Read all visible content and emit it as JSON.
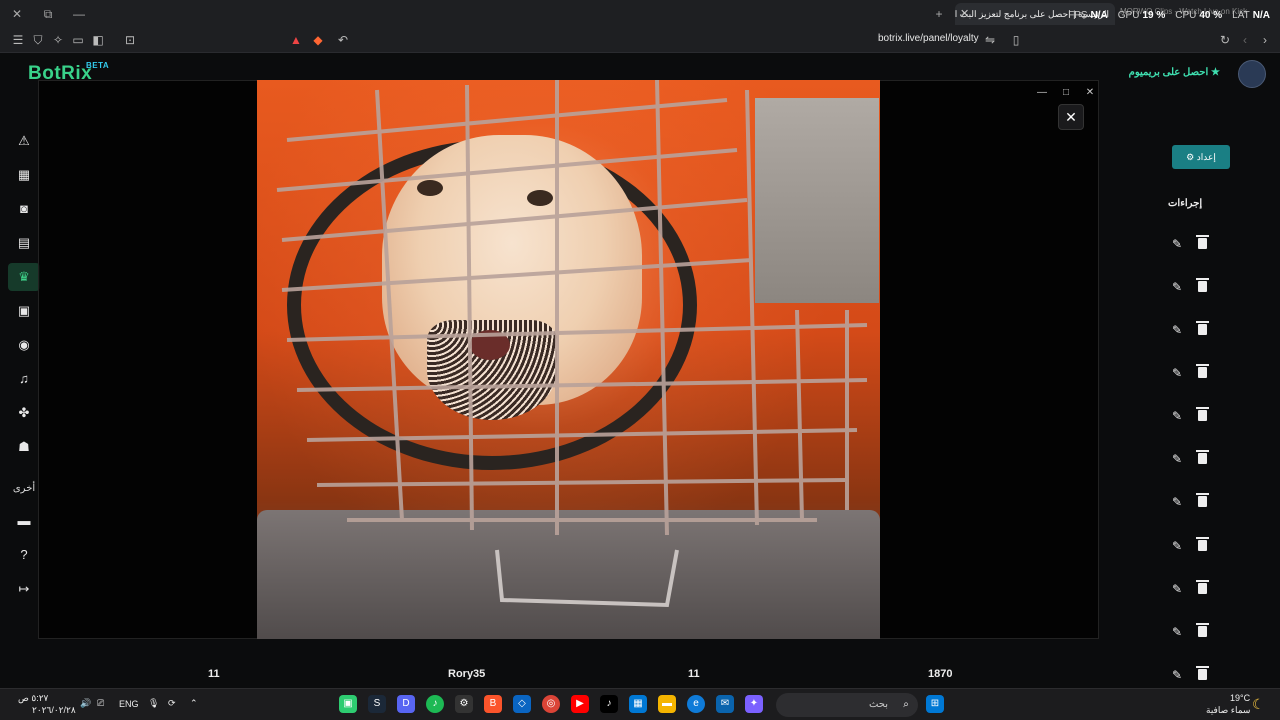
{
  "browser": {
    "tab_title": "الرئيسية | احصل على برنامج لتعزيز البث الخ...",
    "tab2_title": "MORWO Clips - Watch Live on Kick",
    "url": "botrix.live/panel/loyalty",
    "stats": [
      {
        "label": "FPS",
        "value": "N/A"
      },
      {
        "label": "GPU",
        "value": "19 %"
      },
      {
        "label": "CPU",
        "value": "40 %"
      },
      {
        "label": "LAT",
        "value": "N/A"
      }
    ]
  },
  "app": {
    "logo_text": "BotRix",
    "logo_badge": "BETA",
    "premium_label": "احصل على بريميوم",
    "sidebar_other_label": "أخرى",
    "edit_button_label": "إعداد",
    "actions_header": "إجراءات",
    "bottom_row": {
      "c1": "11",
      "name": "Rory35",
      "c3": "11",
      "points": "1870"
    }
  },
  "viewer": {
    "close_symbol": "✕",
    "window_controls": [
      "—",
      "□",
      "✕"
    ]
  },
  "taskbar": {
    "search_placeholder": "بحث",
    "lang": "ENG",
    "time": "٥:٢٧ ص",
    "date": "٢٠٢٦/٠٢/٢٨",
    "temperature": "19°C",
    "weather": "سماء صافية"
  }
}
